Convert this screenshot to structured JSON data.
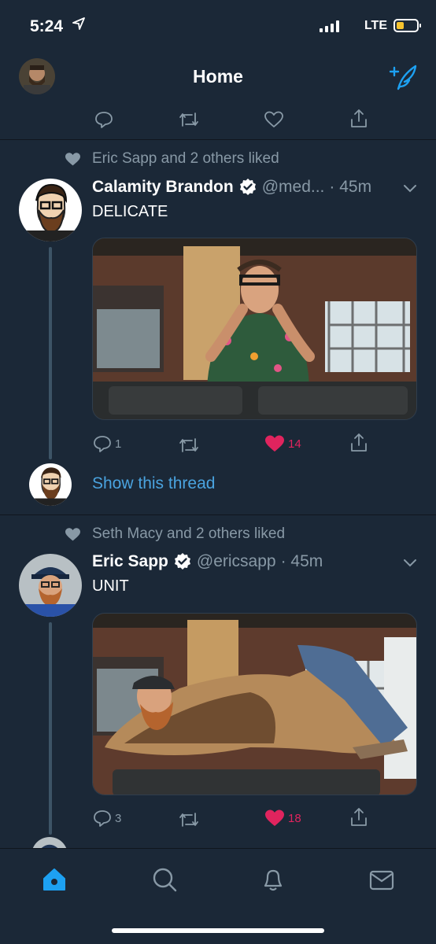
{
  "status_bar": {
    "time": "5:24",
    "network": "LTE"
  },
  "nav": {
    "title": "Home"
  },
  "tweets": [
    {
      "social_context": "Eric Sapp and 2 others liked",
      "name": "Calamity Brandon",
      "handle": "@med...",
      "time": "· 45m",
      "text": "DELICATE",
      "replies": "1",
      "likes": "14",
      "show_thread": "Show this thread"
    },
    {
      "social_context": "Seth Macy and 2 others liked",
      "name": "Eric Sapp",
      "handle": "@ericsapp",
      "time": "· 45m",
      "text": "UNIT",
      "replies": "3",
      "likes": "18"
    }
  ],
  "tabs": [
    "home-icon",
    "search-icon",
    "bell-icon",
    "mail-icon"
  ],
  "colors": {
    "background": "#1b2837",
    "accent": "#1da1f2",
    "like": "#e0245e",
    "muted": "#8899a6"
  }
}
